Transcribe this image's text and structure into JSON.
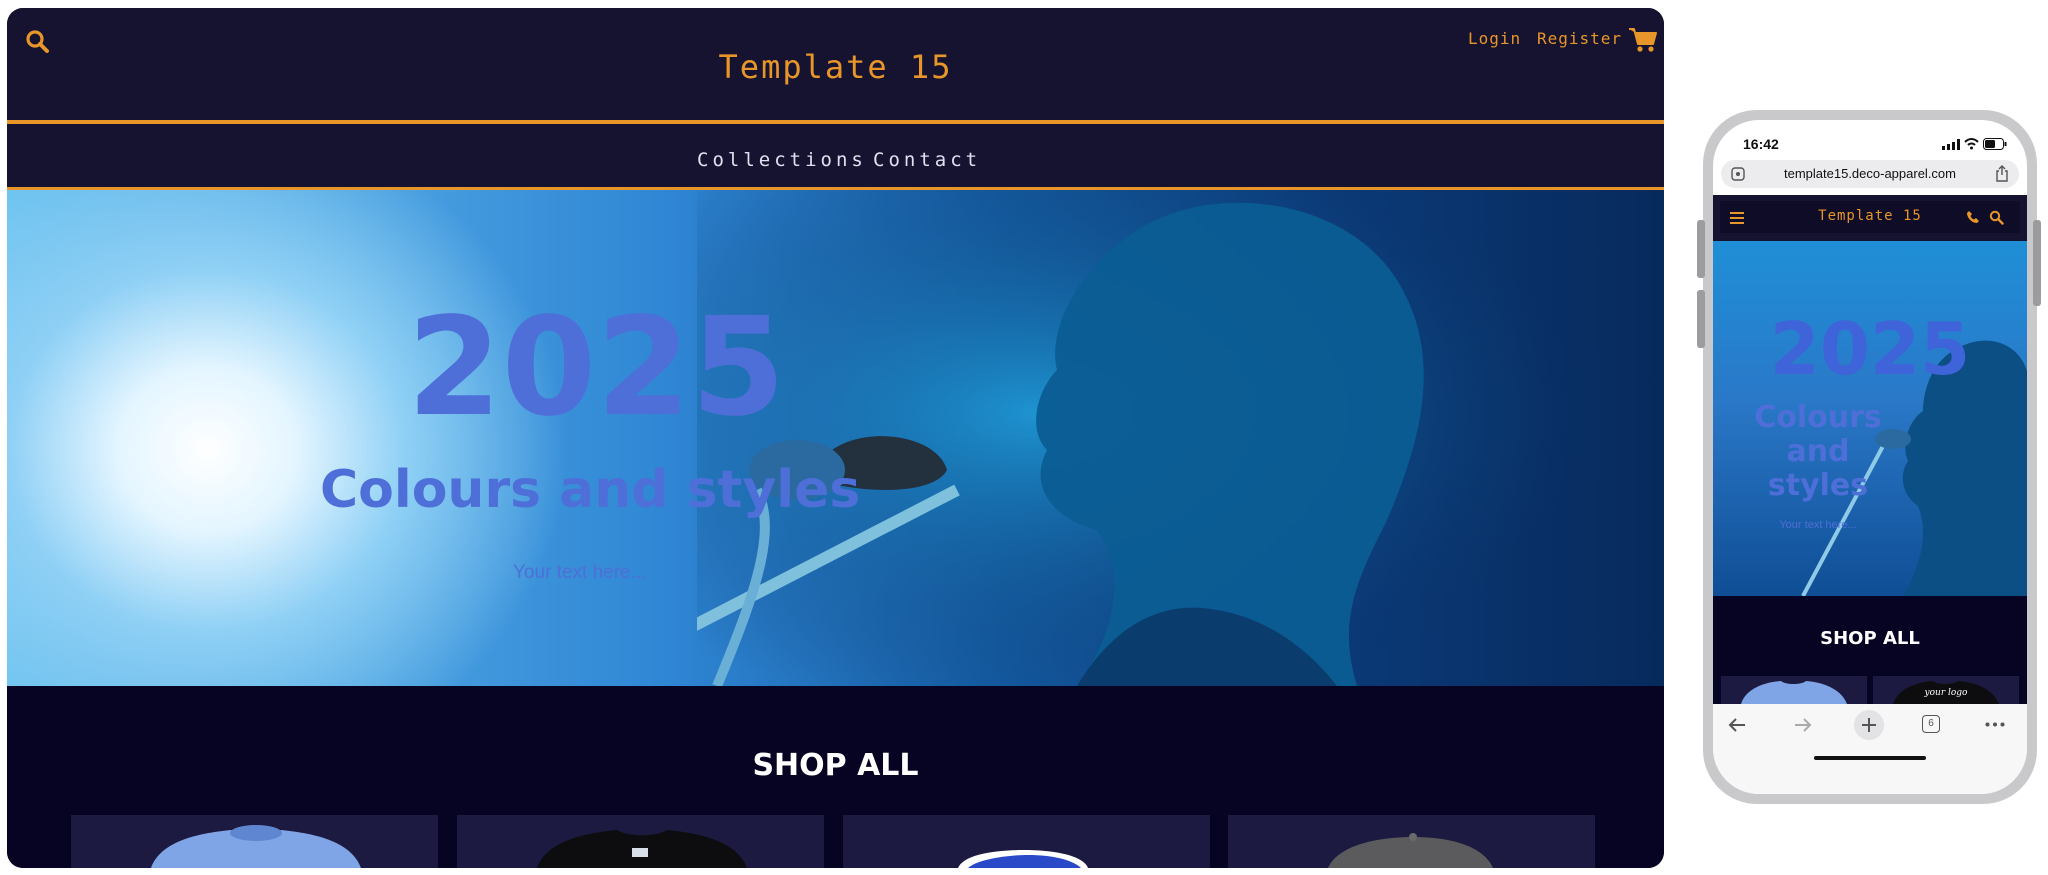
{
  "desktop": {
    "brand": "Template 15",
    "header": {
      "login": "Login",
      "register": "Register"
    },
    "nav": [
      "Collections",
      "Contact"
    ],
    "hero": {
      "year": "2025",
      "subtitle": "Colours and styles",
      "text": "Your text here..."
    },
    "shop": {
      "title": "SHOP ALL"
    }
  },
  "phone": {
    "status": {
      "time": "16:42"
    },
    "url": "template15.deco-apparel.com",
    "brand": "Template 15",
    "hero": {
      "year": "2025",
      "subtitle": [
        "Colours",
        "and",
        "styles"
      ],
      "text": "Your text here..."
    },
    "shop": {
      "title": "SHOP ALL",
      "logo_text": "your logo"
    },
    "toolbar": {
      "tabs_count": "6"
    }
  },
  "colors": {
    "accent": "#e8952a",
    "header_bg": "#15132f",
    "shop_bg": "#060422",
    "hero_text": "#4e6fd8"
  },
  "icons": [
    "search-icon",
    "cart-icon",
    "menu-icon",
    "phone-icon",
    "back-icon",
    "forward-icon",
    "plus-icon",
    "tabs-icon",
    "more-icon",
    "share-icon",
    "reader-icon",
    "wifi-icon",
    "battery-icon",
    "signal-icon"
  ]
}
